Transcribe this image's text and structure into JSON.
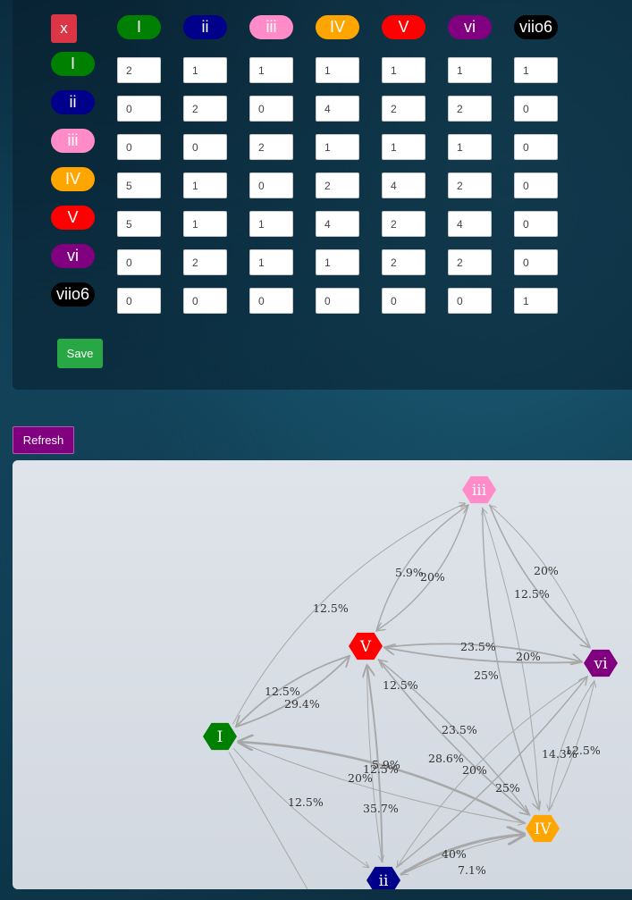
{
  "matrix": {
    "close_label": "x",
    "chords": [
      {
        "label": "I",
        "color": "#008000"
      },
      {
        "label": "ii",
        "color": "#00008b"
      },
      {
        "label": "iii",
        "color": "#ff8cc8"
      },
      {
        "label": "IV",
        "color": "#ffa500"
      },
      {
        "label": "V",
        "color": "#ff0000"
      },
      {
        "label": "vi",
        "color": "#800080"
      },
      {
        "label": "viio6",
        "color": "#000000"
      }
    ],
    "values": [
      [
        "2",
        "1",
        "1",
        "1",
        "1",
        "1",
        "1"
      ],
      [
        "0",
        "2",
        "0",
        "4",
        "2",
        "2",
        "0"
      ],
      [
        "0",
        "0",
        "2",
        "1",
        "1",
        "1",
        "0"
      ],
      [
        "5",
        "1",
        "0",
        "2",
        "4",
        "2",
        "0"
      ],
      [
        "5",
        "1",
        "1",
        "4",
        "2",
        "4",
        "0"
      ],
      [
        "0",
        "2",
        "1",
        "1",
        "2",
        "2",
        "0"
      ],
      [
        "0",
        "0",
        "0",
        "0",
        "0",
        "0",
        "1"
      ]
    ],
    "save_label": "Save"
  },
  "refresh_label": "Refresh",
  "graph": {
    "nodes": [
      {
        "id": "iii",
        "label": "iii",
        "color": "#ff8cc8"
      },
      {
        "id": "V",
        "label": "V",
        "color": "#ff0000"
      },
      {
        "id": "vi",
        "label": "vi",
        "color": "#800080"
      },
      {
        "id": "I",
        "label": "I",
        "color": "#008000"
      },
      {
        "id": "IV",
        "label": "IV",
        "color": "#ffa500"
      },
      {
        "id": "ii",
        "label": "ii",
        "color": "#00008b"
      }
    ],
    "edge_labels": [
      "5.9%",
      "20%",
      "20%",
      "12.5%",
      "12.5%",
      "23.5%",
      "20%",
      "25%",
      "12.5%",
      "29.4%",
      "12.5%",
      "23.5%",
      "28.6%",
      "20%",
      "25%",
      "14.3%",
      "12.5%",
      "5.9%",
      "12.5%",
      "20%",
      "35.7%",
      "12.5%",
      "40%",
      "7.1%"
    ]
  }
}
